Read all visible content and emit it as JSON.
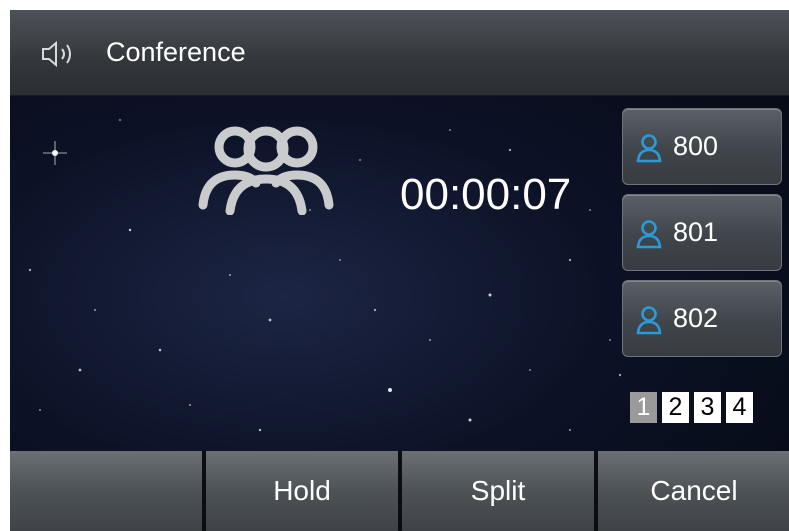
{
  "header": {
    "title": "Conference",
    "icon": "speaker-icon"
  },
  "call": {
    "timer": "00:00:07",
    "icon": "group-icon"
  },
  "members": [
    {
      "number": "800",
      "icon": "user-icon"
    },
    {
      "number": "801",
      "icon": "user-icon"
    },
    {
      "number": "802",
      "icon": "user-icon"
    }
  ],
  "pages": [
    "1",
    "2",
    "3",
    "4"
  ],
  "active_page": "1",
  "softkeys": [
    "",
    "Hold",
    "Split",
    "Cancel"
  ],
  "colors": {
    "accent_blue": "#2b9ad6",
    "page_active": "#9a9a9a"
  }
}
